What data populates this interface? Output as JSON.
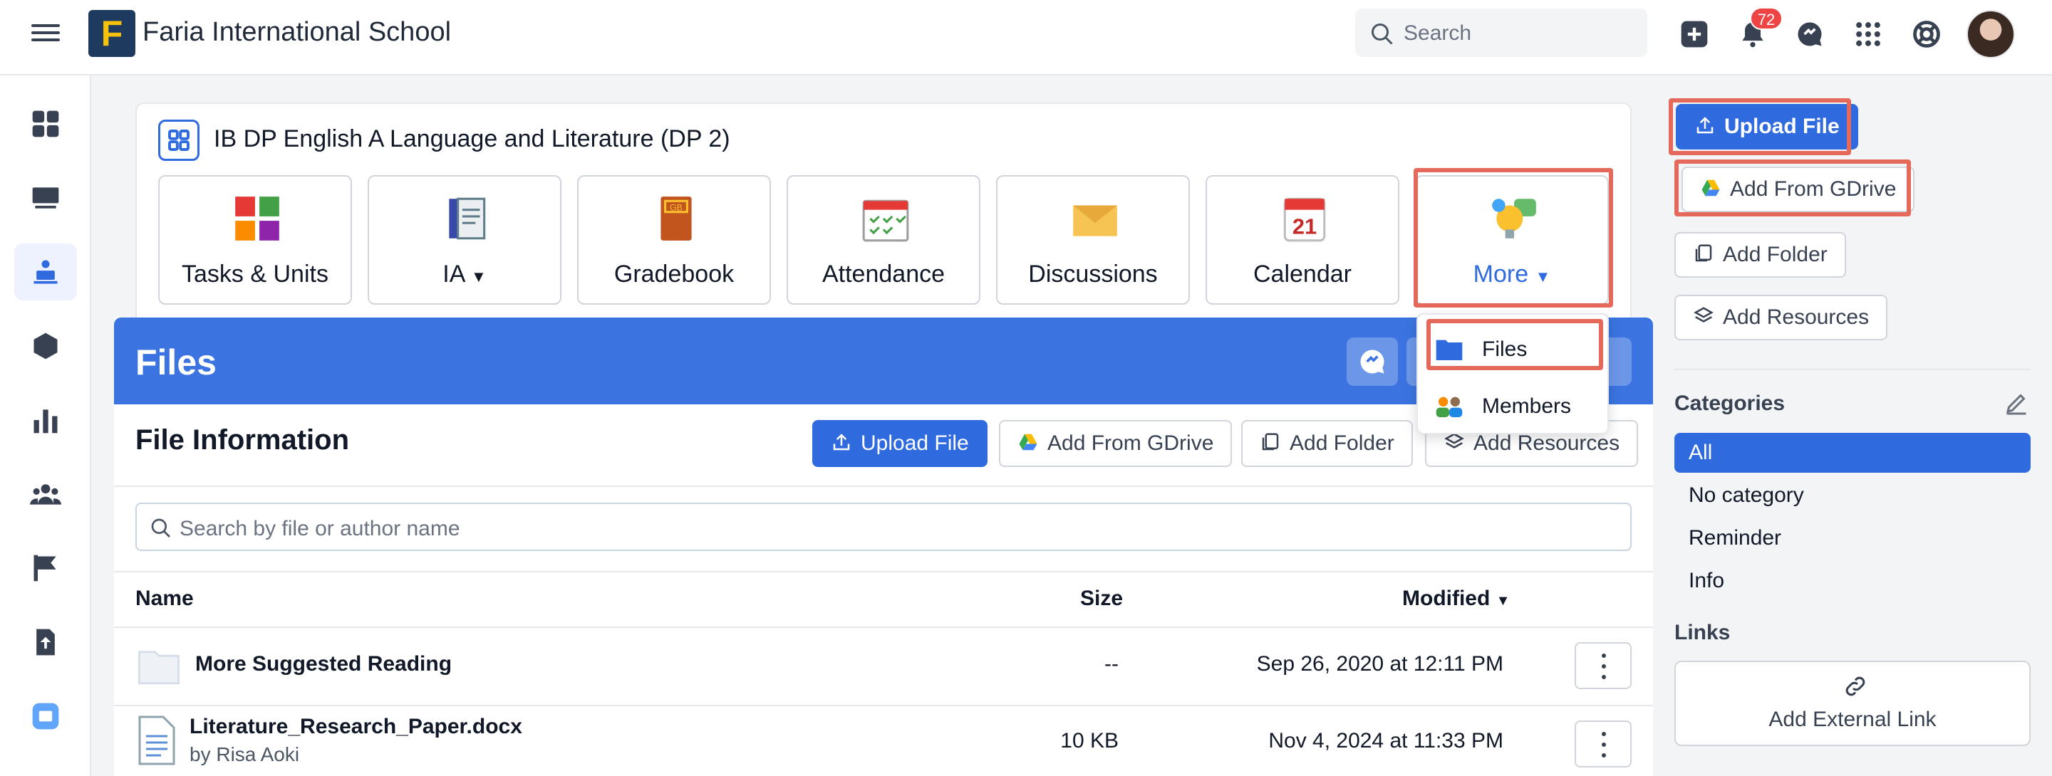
{
  "header": {
    "school_name": "Faria International School",
    "logo_letter": "F",
    "search_placeholder": "Search",
    "notification_count": "72"
  },
  "course": {
    "title": "IB DP English A Language and Literature (DP 2)",
    "tiles": [
      {
        "label": "Tasks & Units",
        "icon": "puzzle-icon"
      },
      {
        "label": "IA",
        "icon": "notebook-icon",
        "dropdown": true
      },
      {
        "label": "Gradebook",
        "icon": "gradebook-icon",
        "art_text": "GB"
      },
      {
        "label": "Attendance",
        "icon": "attendance-icon"
      },
      {
        "label": "Discussions",
        "icon": "envelope-icon"
      },
      {
        "label": "Calendar",
        "icon": "calendar-icon",
        "art_text": "21"
      },
      {
        "label": "More",
        "icon": "lightbulb-chat-icon",
        "dropdown": true
      }
    ]
  },
  "more_menu": {
    "items": [
      {
        "label": "Files",
        "icon": "folder-icon"
      },
      {
        "label": "Members",
        "icon": "members-icon"
      }
    ]
  },
  "files_panel": {
    "title": "Files",
    "section_title": "File Information",
    "upload_label": "Upload File",
    "gdrive_label": "Add From GDrive",
    "folder_label": "Add Folder",
    "resources_label": "Add Resources",
    "search_placeholder": "Search by file or author name",
    "columns": {
      "name": "Name",
      "size": "Size",
      "modified": "Modified"
    },
    "rows": [
      {
        "name": "More Suggested Reading",
        "author": "",
        "size": "--",
        "modified": "Sep 26, 2020 at 12:11 PM",
        "type": "folder"
      },
      {
        "name": "Literature_Research_Paper.docx",
        "author": "by Risa Aoki",
        "size": "10 KB",
        "modified": "Nov 4, 2024 at 11:33 PM",
        "type": "document"
      }
    ]
  },
  "sidebar": {
    "upload_label": "Upload File",
    "gdrive_label": "Add From GDrive",
    "folder_label": "Add Folder",
    "resources_label": "Add Resources",
    "categories_title": "Categories",
    "categories": [
      "All",
      "No category",
      "Reminder",
      "Info"
    ],
    "links_title": "Links",
    "add_link_label": "Add External Link"
  },
  "colors": {
    "accent": "#2f6bde",
    "header_blue": "#3b74e0",
    "highlight": "#e5695b",
    "badge": "#ef4444"
  }
}
